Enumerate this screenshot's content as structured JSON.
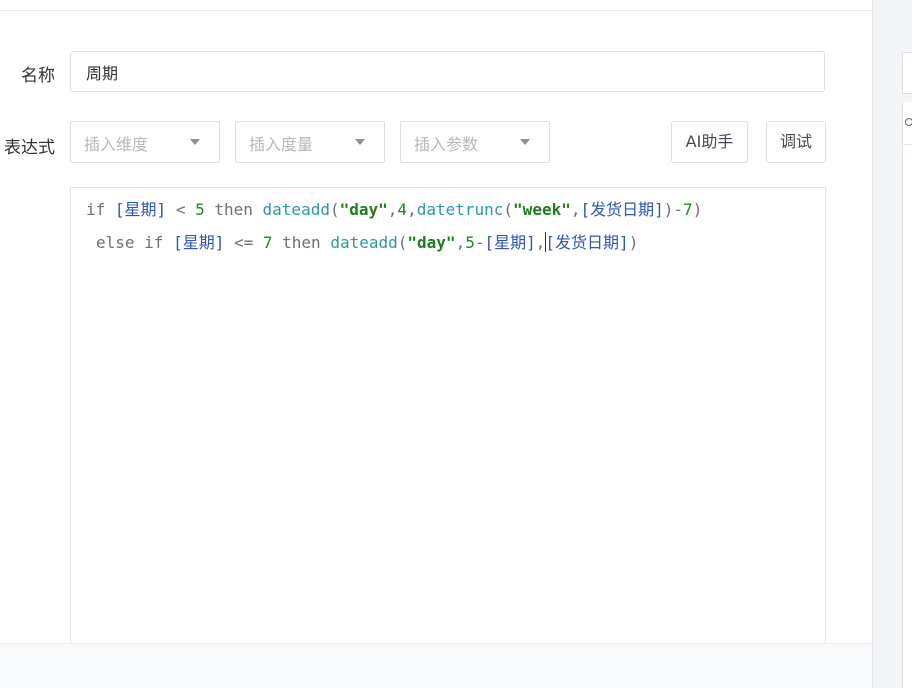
{
  "form": {
    "name_label": "名称",
    "name_value": "周期",
    "expression_label": "表达式"
  },
  "toolbar": {
    "insert_dimension_placeholder": "插入维度",
    "insert_measure_placeholder": "插入度量",
    "insert_parameter_placeholder": "插入参数",
    "ai_assistant_label": "AI助手",
    "debug_label": "调试"
  },
  "editor": {
    "line1": [
      {
        "t": "if ",
        "c": "kw"
      },
      {
        "t": "[星期]",
        "c": "fld"
      },
      {
        "t": " < ",
        "c": "kw"
      },
      {
        "t": "5",
        "c": "num"
      },
      {
        "t": " then ",
        "c": "kw"
      },
      {
        "t": "dateadd",
        "c": "fn"
      },
      {
        "t": "(",
        "c": "pn"
      },
      {
        "t": "\"day\"",
        "c": "str"
      },
      {
        "t": ",",
        "c": "pn"
      },
      {
        "t": "4",
        "c": "num"
      },
      {
        "t": ",",
        "c": "pn"
      },
      {
        "t": "datetrunc",
        "c": "fn"
      },
      {
        "t": "(",
        "c": "pn"
      },
      {
        "t": "\"week\"",
        "c": "str"
      },
      {
        "t": ",",
        "c": "pn"
      },
      {
        "t": "[发货日期]",
        "c": "fld"
      },
      {
        "t": ")",
        "c": "pn"
      },
      {
        "t": "-",
        "c": "pn"
      },
      {
        "t": "7",
        "c": "num"
      },
      {
        "t": ")",
        "c": "pn"
      }
    ],
    "line2": [
      {
        "t": "else if ",
        "c": "kw"
      },
      {
        "t": "[星期]",
        "c": "fld"
      },
      {
        "t": " <= ",
        "c": "kw"
      },
      {
        "t": "7",
        "c": "num"
      },
      {
        "t": " then ",
        "c": "kw"
      },
      {
        "t": "dateadd",
        "c": "fn"
      },
      {
        "t": "(",
        "c": "pn"
      },
      {
        "t": "\"day\"",
        "c": "str"
      },
      {
        "t": ",",
        "c": "pn"
      },
      {
        "t": "5",
        "c": "num"
      },
      {
        "t": "-",
        "c": "pn"
      },
      {
        "t": "[星期]",
        "c": "fld"
      },
      {
        "t": ",",
        "c": "pn"
      },
      {
        "t": "",
        "c": "cursor"
      },
      {
        "t": "[发货日期]",
        "c": "fld"
      },
      {
        "t": ")",
        "c": "pn"
      }
    ]
  }
}
